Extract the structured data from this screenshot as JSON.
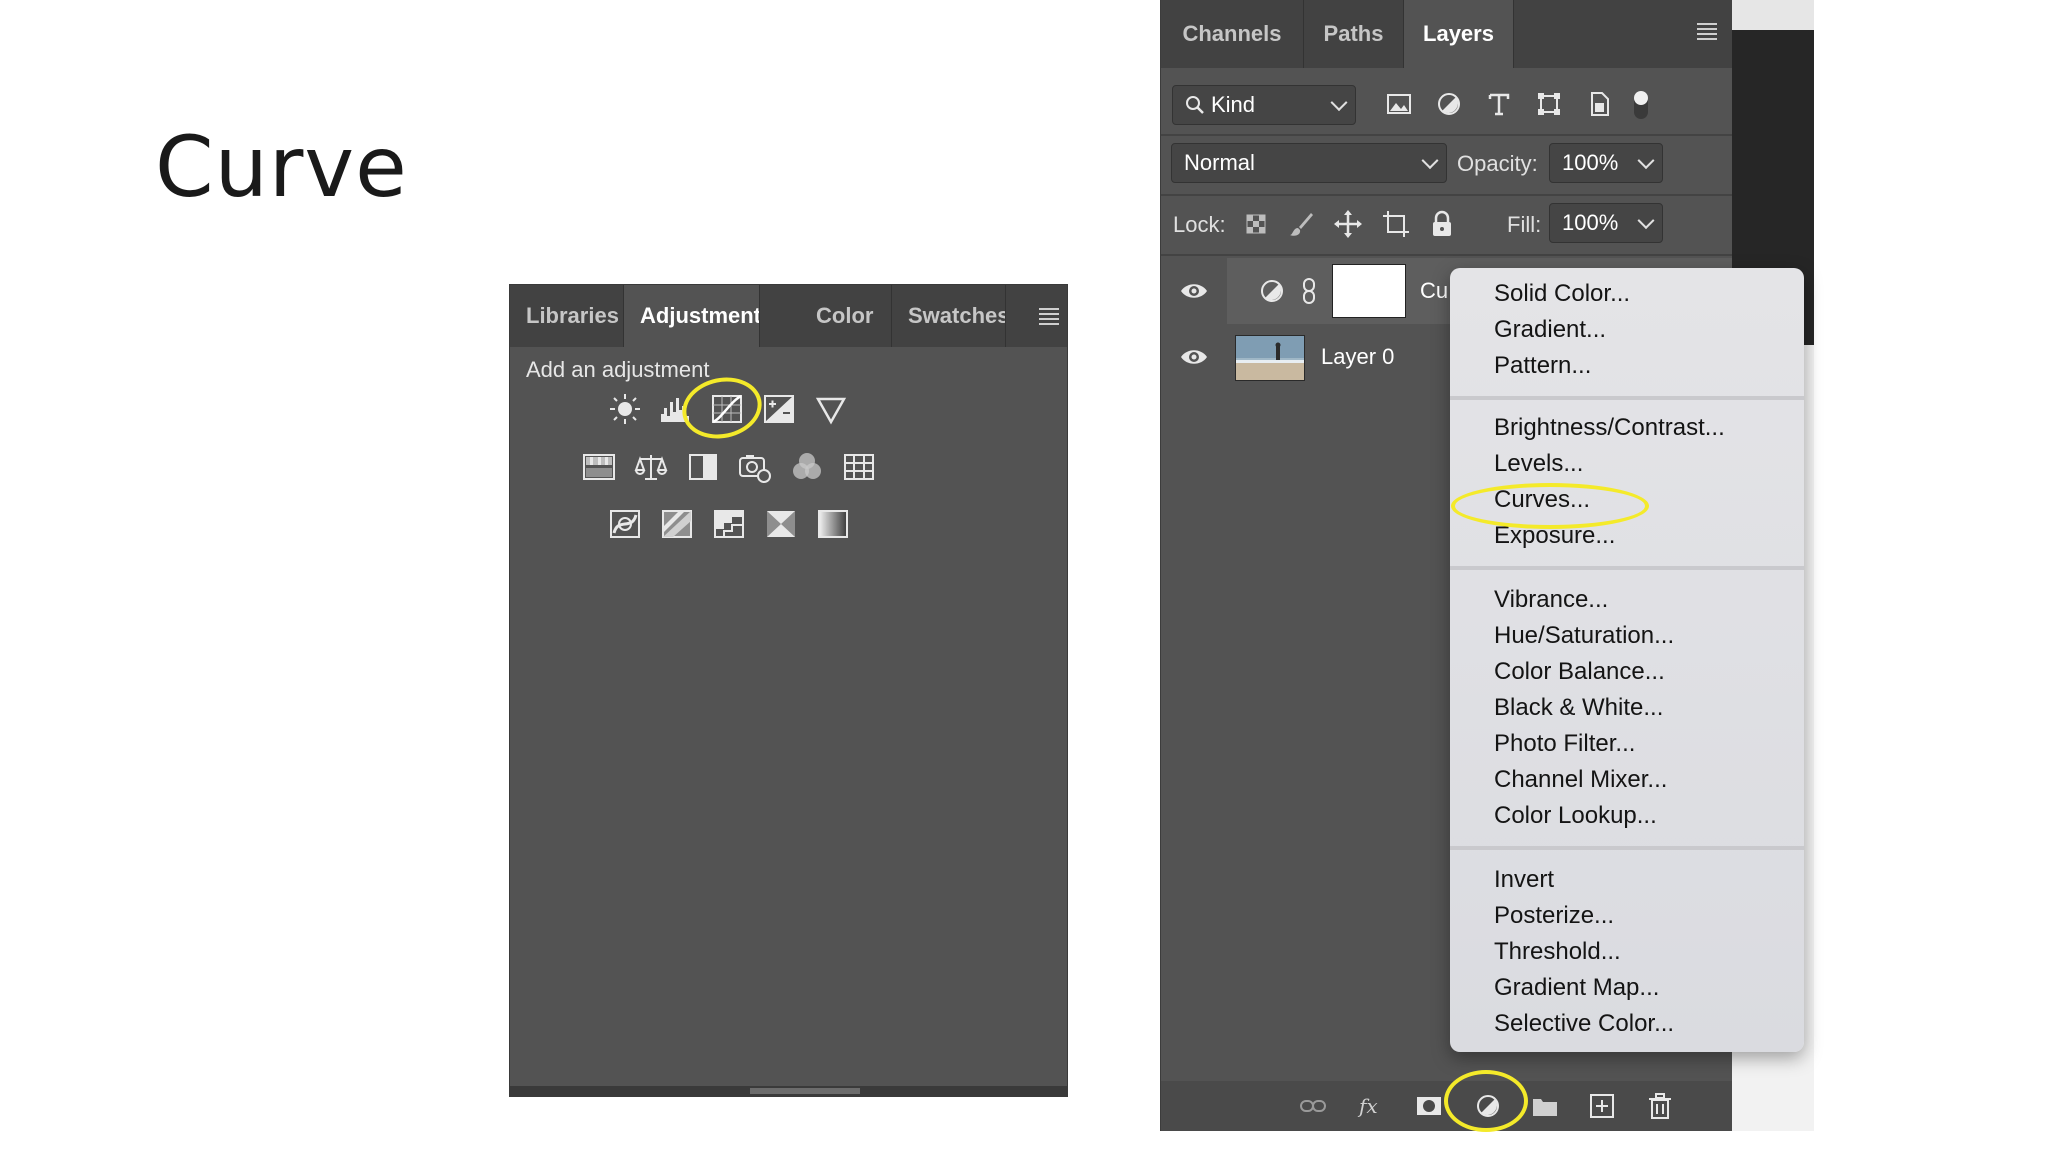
{
  "slide": {
    "title": "Curve"
  },
  "adjustments_panel": {
    "tabs": [
      {
        "label": "Libraries"
      },
      {
        "label": "Adjustments",
        "active": true
      },
      {
        "label": "Color"
      },
      {
        "label": "Swatches"
      }
    ],
    "hint": "Add an adjustment",
    "icons": {
      "row1": [
        "brightness-contrast-icon",
        "levels-icon",
        "curves-icon",
        "exposure-icon",
        "vibrance-icon"
      ],
      "row2": [
        "hue-saturation-icon",
        "color-balance-icon",
        "black-white-icon",
        "photo-filter-icon",
        "channel-mixer-icon",
        "color-lookup-icon"
      ],
      "row3": [
        "invert-icon",
        "posterize-icon",
        "threshold-icon",
        "selective-color-icon",
        "gradient-map-icon"
      ]
    },
    "highlighted": "curves-icon"
  },
  "layers_panel": {
    "tabs": [
      {
        "label": "Channels"
      },
      {
        "label": "Paths"
      },
      {
        "label": "Layers",
        "active": true
      }
    ],
    "filter": {
      "label": "Kind"
    },
    "blend_mode": "Normal",
    "opacity": {
      "label": "Opacity:",
      "value": "100%"
    },
    "lock": {
      "label": "Lock:"
    },
    "fill": {
      "label": "Fill:",
      "value": "100%"
    },
    "layers": [
      {
        "name": "Cu",
        "type": "adjustment"
      },
      {
        "name": "Layer 0",
        "type": "pixel"
      }
    ]
  },
  "context_menu": {
    "groups": [
      [
        "Solid Color...",
        "Gradient...",
        "Pattern..."
      ],
      [
        "Brightness/Contrast...",
        "Levels...",
        "Curves...",
        "Exposure..."
      ],
      [
        "Vibrance...",
        "Hue/Saturation...",
        "Color Balance...",
        "Black & White...",
        "Photo Filter...",
        "Channel Mixer...",
        "Color Lookup..."
      ],
      [
        "Invert",
        "Posterize...",
        "Threshold...",
        "Gradient Map...",
        "Selective Color..."
      ]
    ],
    "highlighted": "Curves..."
  },
  "colors": {
    "highlight": "#f4ea2a",
    "panel": "#535353",
    "tabbar": "#424242"
  }
}
